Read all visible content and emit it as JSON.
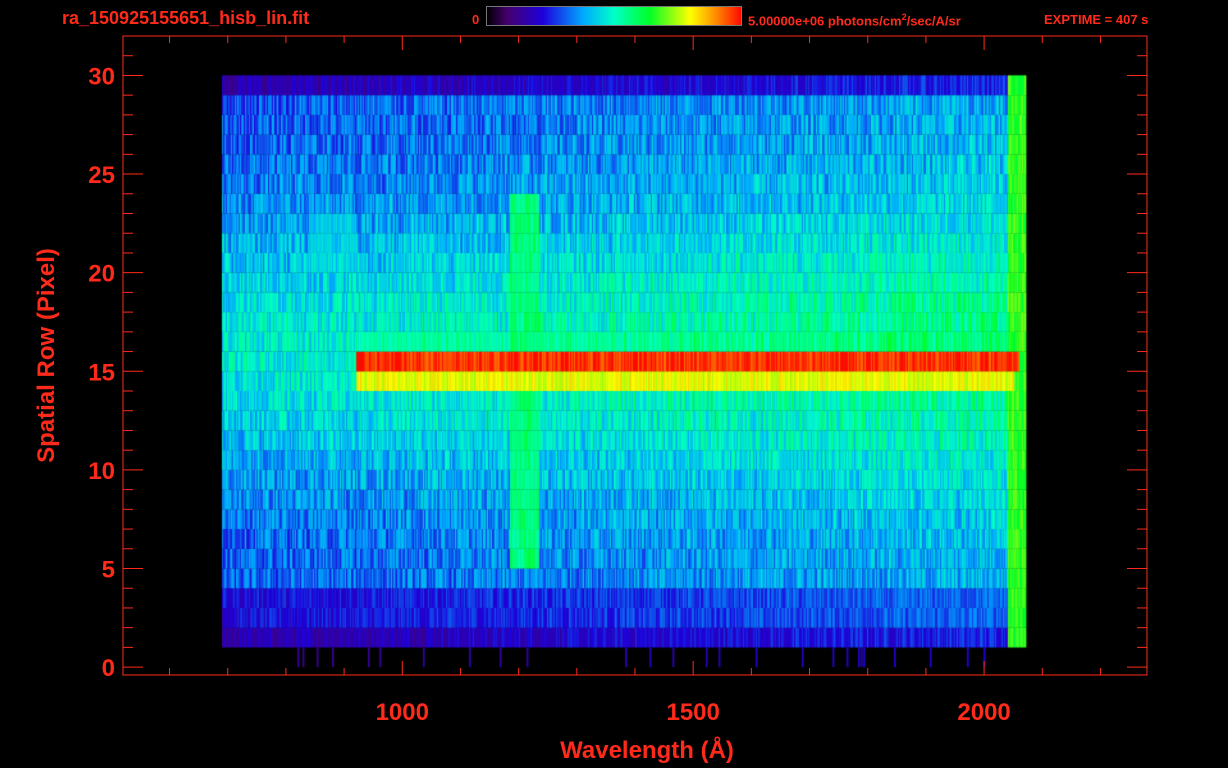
{
  "header": {
    "file_title": "ra_150925155651_hisb_lin.fit",
    "colorbar_min": "0",
    "colorbar_max_value": "5.00000e+06",
    "colorbar_max_unit_pre": " photons/cm",
    "colorbar_max_unit_sup": "2",
    "colorbar_max_unit_post": "/sec/A/sr",
    "exptime": "EXPTIME = 407 s"
  },
  "colors": {
    "background": "#000000",
    "axis": "#ff2a1a",
    "text": "#ff2a1a"
  },
  "chart_data": {
    "type": "heatmap",
    "title": "",
    "xlabel": "Wavelength (Å)",
    "ylabel": "Spatial Row (Pixel)",
    "xlim": [
      520,
      2280
    ],
    "ylim": [
      -0.4,
      32
    ],
    "xticks": [
      1000,
      1500,
      2000
    ],
    "yticks": [
      0,
      5,
      10,
      15,
      20,
      25,
      30
    ],
    "grid": false,
    "colormap": "rainbow (black-purple-blue-cyan-green-yellow-red)",
    "color_range": [
      0,
      5000000
    ],
    "color_units": "photons/cm^2/sec/A/sr",
    "data_extent": {
      "x": [
        690,
        2070
      ],
      "y": [
        0,
        30
      ]
    },
    "features": [
      {
        "label": "bright continuum band",
        "x": [
          920,
          2060
        ],
        "y": [
          15,
          16
        ],
        "level": 1.0
      },
      {
        "label": "continuum wing",
        "x": [
          920,
          2050
        ],
        "y": [
          14,
          15
        ],
        "level": 0.82
      },
      {
        "label": "continuum wing",
        "x": [
          920,
          2050
        ],
        "y": [
          16,
          17
        ],
        "level": 0.55
      },
      {
        "label": "emission line",
        "x": [
          1185,
          1235
        ],
        "y": [
          5,
          24
        ],
        "level": 0.6
      },
      {
        "label": "diffuse feature",
        "x": [
          840,
          920
        ],
        "y": [
          20,
          23
        ],
        "level": 0.45
      },
      {
        "label": "detector edge",
        "x": [
          2040,
          2070
        ],
        "y": [
          1,
          30
        ],
        "level": 0.7
      }
    ]
  }
}
